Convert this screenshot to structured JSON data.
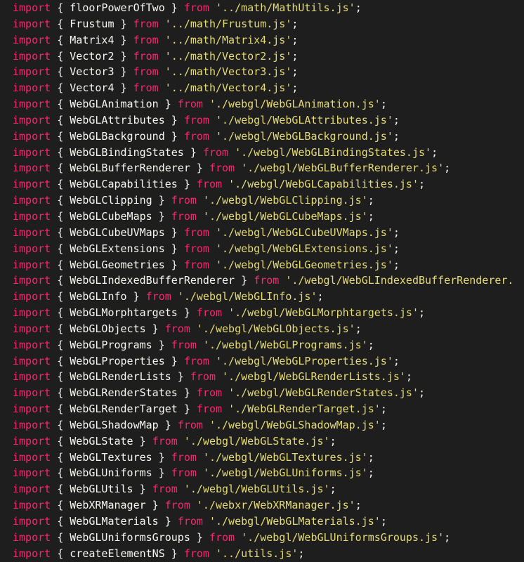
{
  "colors": {
    "background": "#1e1e1e",
    "keyword": "#f92672",
    "identifier": "#f8f8f2",
    "string": "#e6db74"
  },
  "lines": [
    {
      "kw": "import",
      "name": "floorPowerOfTwo",
      "from": "from",
      "path": "'../math/MathUtils.js'"
    },
    {
      "kw": "import",
      "name": "Frustum",
      "from": "from",
      "path": "'../math/Frustum.js'"
    },
    {
      "kw": "import",
      "name": "Matrix4",
      "from": "from",
      "path": "'../math/Matrix4.js'"
    },
    {
      "kw": "import",
      "name": "Vector2",
      "from": "from",
      "path": "'../math/Vector2.js'"
    },
    {
      "kw": "import",
      "name": "Vector3",
      "from": "from",
      "path": "'../math/Vector3.js'"
    },
    {
      "kw": "import",
      "name": "Vector4",
      "from": "from",
      "path": "'../math/Vector4.js'"
    },
    {
      "kw": "import",
      "name": "WebGLAnimation",
      "from": "from",
      "path": "'./webgl/WebGLAnimation.js'"
    },
    {
      "kw": "import",
      "name": "WebGLAttributes",
      "from": "from",
      "path": "'./webgl/WebGLAttributes.js'"
    },
    {
      "kw": "import",
      "name": "WebGLBackground",
      "from": "from",
      "path": "'./webgl/WebGLBackground.js'"
    },
    {
      "kw": "import",
      "name": "WebGLBindingStates",
      "from": "from",
      "path": "'./webgl/WebGLBindingStates.js'"
    },
    {
      "kw": "import",
      "name": "WebGLBufferRenderer",
      "from": "from",
      "path": "'./webgl/WebGLBufferRenderer.js'"
    },
    {
      "kw": "import",
      "name": "WebGLCapabilities",
      "from": "from",
      "path": "'./webgl/WebGLCapabilities.js'"
    },
    {
      "kw": "import",
      "name": "WebGLClipping",
      "from": "from",
      "path": "'./webgl/WebGLClipping.js'"
    },
    {
      "kw": "import",
      "name": "WebGLCubeMaps",
      "from": "from",
      "path": "'./webgl/WebGLCubeMaps.js'"
    },
    {
      "kw": "import",
      "name": "WebGLCubeUVMaps",
      "from": "from",
      "path": "'./webgl/WebGLCubeUVMaps.js'"
    },
    {
      "kw": "import",
      "name": "WebGLExtensions",
      "from": "from",
      "path": "'./webgl/WebGLExtensions.js'"
    },
    {
      "kw": "import",
      "name": "WebGLGeometries",
      "from": "from",
      "path": "'./webgl/WebGLGeometries.js'"
    },
    {
      "kw": "import",
      "name": "WebGLIndexedBufferRenderer",
      "from": "from",
      "path": "'./webgl/WebGLIndexedBufferRenderer."
    },
    {
      "kw": "import",
      "name": "WebGLInfo",
      "from": "from",
      "path": "'./webgl/WebGLInfo.js'"
    },
    {
      "kw": "import",
      "name": "WebGLMorphtargets",
      "from": "from",
      "path": "'./webgl/WebGLMorphtargets.js'"
    },
    {
      "kw": "import",
      "name": "WebGLObjects",
      "from": "from",
      "path": "'./webgl/WebGLObjects.js'"
    },
    {
      "kw": "import",
      "name": "WebGLPrograms",
      "from": "from",
      "path": "'./webgl/WebGLPrograms.js'"
    },
    {
      "kw": "import",
      "name": "WebGLProperties",
      "from": "from",
      "path": "'./webgl/WebGLProperties.js'"
    },
    {
      "kw": "import",
      "name": "WebGLRenderLists",
      "from": "from",
      "path": "'./webgl/WebGLRenderLists.js'"
    },
    {
      "kw": "import",
      "name": "WebGLRenderStates",
      "from": "from",
      "path": "'./webgl/WebGLRenderStates.js'"
    },
    {
      "kw": "import",
      "name": "WebGLRenderTarget",
      "from": "from",
      "path": "'./WebGLRenderTarget.js'"
    },
    {
      "kw": "import",
      "name": "WebGLShadowMap",
      "from": "from",
      "path": "'./webgl/WebGLShadowMap.js'"
    },
    {
      "kw": "import",
      "name": "WebGLState",
      "from": "from",
      "path": "'./webgl/WebGLState.js'"
    },
    {
      "kw": "import",
      "name": "WebGLTextures",
      "from": "from",
      "path": "'./webgl/WebGLTextures.js'"
    },
    {
      "kw": "import",
      "name": "WebGLUniforms",
      "from": "from",
      "path": "'./webgl/WebGLUniforms.js'"
    },
    {
      "kw": "import",
      "name": "WebGLUtils",
      "from": "from",
      "path": "'./webgl/WebGLUtils.js'"
    },
    {
      "kw": "import",
      "name": "WebXRManager",
      "from": "from",
      "path": "'./webxr/WebXRManager.js'"
    },
    {
      "kw": "import",
      "name": "WebGLMaterials",
      "from": "from",
      "path": "'./webgl/WebGLMaterials.js'"
    },
    {
      "kw": "import",
      "name": "WebGLUniformsGroups",
      "from": "from",
      "path": "'./webgl/WebGLUniformsGroups.js'"
    },
    {
      "kw": "import",
      "name": "createElementNS",
      "from": "from",
      "path": "'../utils.js'"
    }
  ]
}
